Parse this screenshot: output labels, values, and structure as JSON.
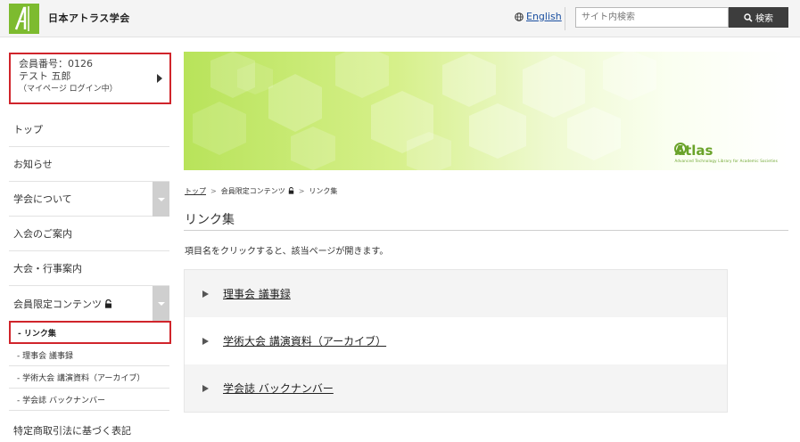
{
  "header": {
    "site_name": "日本アトラス学会",
    "language_link": "English",
    "search_placeholder": "サイト内検索",
    "search_button": "検索"
  },
  "member": {
    "number": "会員番号：0126",
    "name": "テスト 五郎",
    "status": "（マイページ ログイン中）"
  },
  "sidebar": {
    "items": [
      {
        "label": "トップ"
      },
      {
        "label": "お知らせ"
      },
      {
        "label": "学会について"
      },
      {
        "label": "入会のご案内"
      },
      {
        "label": "大会・行事案内"
      },
      {
        "label": "会員限定コンテンツ"
      }
    ],
    "active_sub": "- リンク集",
    "subitems": [
      {
        "label": "- 理事会 議事録"
      },
      {
        "label": "- 学術大会 講演資料（アーカイブ）"
      },
      {
        "label": "- 学会誌 バックナンバー"
      }
    ],
    "last_item": "特定商取引法に基づく表記"
  },
  "banner": {
    "logo_text": "Atlas",
    "logo_tagline": "Advanced Technology Library for Academic Societies"
  },
  "breadcrumb": [
    "トップ",
    "会員限定コンテンツ",
    "リンク集"
  ],
  "main": {
    "title": "リンク集",
    "intro": "項目名をクリックすると、該当ページが開きます。",
    "links": [
      {
        "label": "理事会 議事録"
      },
      {
        "label": "学術大会 講演資料（アーカイブ）"
      },
      {
        "label": "学会誌 バックナンバー"
      }
    ]
  },
  "colors": {
    "brand_green": "#7dbb2f",
    "highlight_red": "#d0242b",
    "search_button": "#3d3d3d"
  }
}
